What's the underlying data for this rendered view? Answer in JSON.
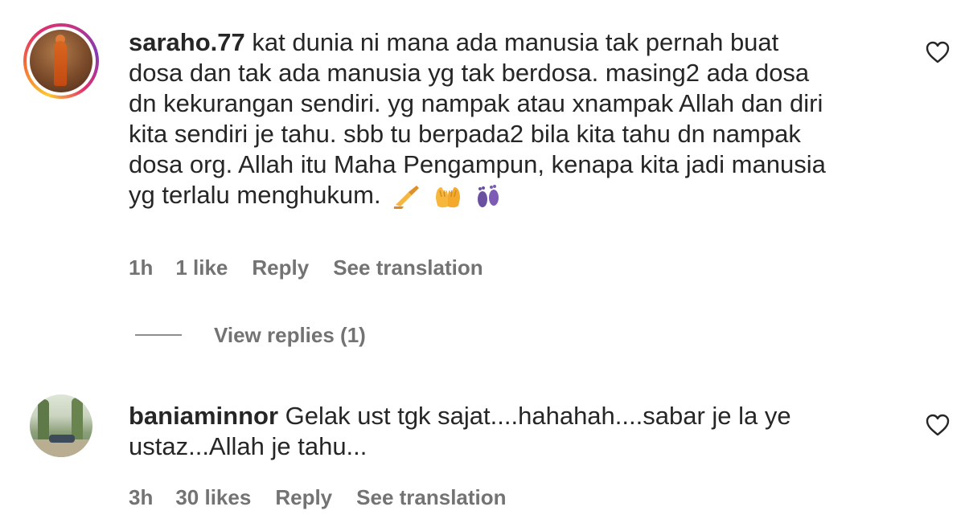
{
  "comments": [
    {
      "username": "saraho.77",
      "lines": [
        "kat dunia ni mana ada manusia tak pernah buat",
        "dosa dan tak ada manusia yg tak berdosa. masing2 ada dosa",
        "dn kekurangan sendiri. yg nampak atau xnampak Allah dan diri",
        "kita sendiri je tahu. sbb tu berpada2 bila kita tahu dn nampak",
        "dosa org. Allah itu Maha Pengampun, kenapa kita jadi manusia",
        "yg terlalu menghukum."
      ],
      "emojis": [
        "writing-hand-emoji",
        "raised-hands-emoji",
        "footprints-emoji"
      ],
      "time": "1h",
      "likes": "1 like",
      "reply_label": "Reply",
      "translate_label": "See translation",
      "view_replies": "View replies (1)"
    },
    {
      "username": "baniaminnor",
      "lines": [
        "Gelak ust tgk sajat....hahahah....sabar je la ye",
        "ustaz...Allah je tahu..."
      ],
      "time": "3h",
      "likes": "30 likes",
      "reply_label": "Reply",
      "translate_label": "See translation"
    }
  ],
  "colors": {
    "text": "#262626",
    "secondary": "#737373",
    "story_ring": [
      "#fdc830",
      "#f37335",
      "#e1306c",
      "#833ab4"
    ]
  }
}
